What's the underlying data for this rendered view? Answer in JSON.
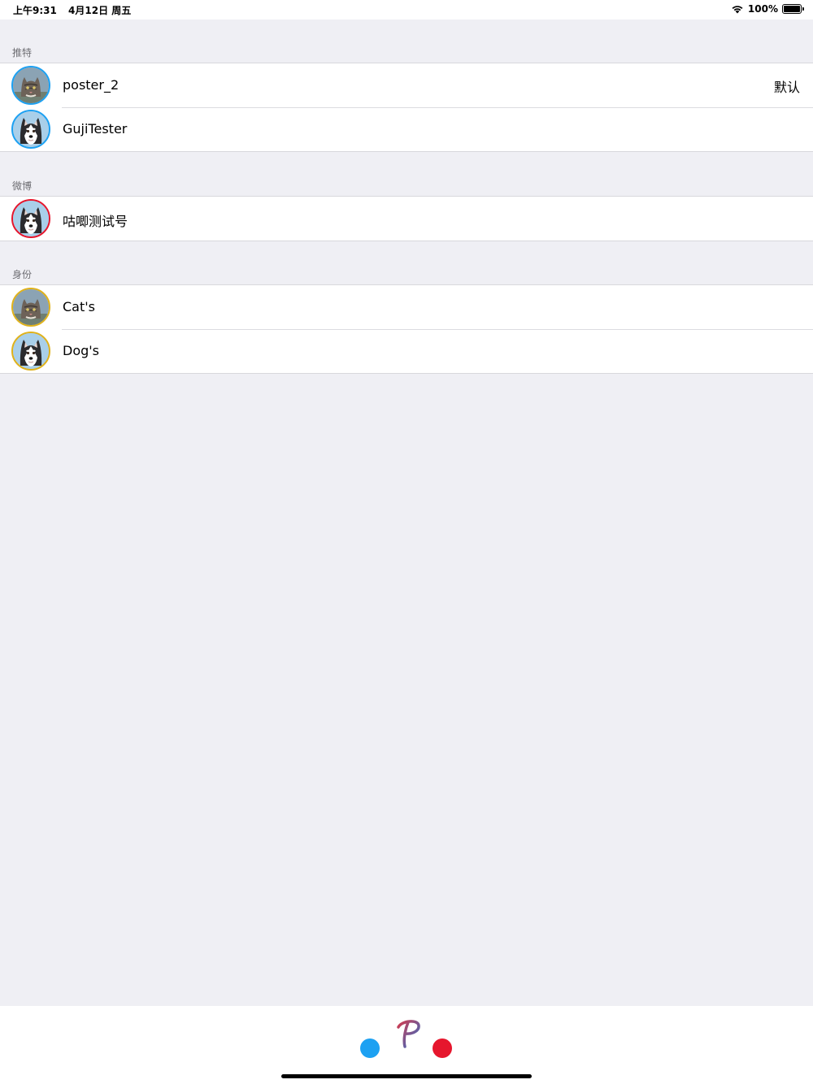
{
  "status_bar": {
    "time": "上午9:31",
    "date": "4月12日 周五",
    "battery": "100%",
    "battery_level": 1.0
  },
  "sections": [
    {
      "header": "推特",
      "accent": "#1da1f2",
      "rows": [
        {
          "label": "poster_2",
          "detail": "默认",
          "avatar": "cat"
        },
        {
          "label": "GujiTester",
          "detail": "",
          "avatar": "husky"
        }
      ]
    },
    {
      "header": "微博",
      "accent": "#e6162d",
      "rows": [
        {
          "label": "咕唧测试号",
          "detail": "",
          "avatar": "husky"
        }
      ]
    },
    {
      "header": "身份",
      "accent": "#e0b21b",
      "rows": [
        {
          "label": "Cat's",
          "detail": "",
          "avatar": "cat"
        },
        {
          "label": "Dog's",
          "detail": "",
          "avatar": "husky"
        }
      ]
    }
  ],
  "bottom_bar": {
    "left_dot_color": "#1da1f2",
    "right_dot_color": "#e6162d",
    "logo_glyph": "P",
    "logo_icon": "p-script-logo-icon"
  }
}
